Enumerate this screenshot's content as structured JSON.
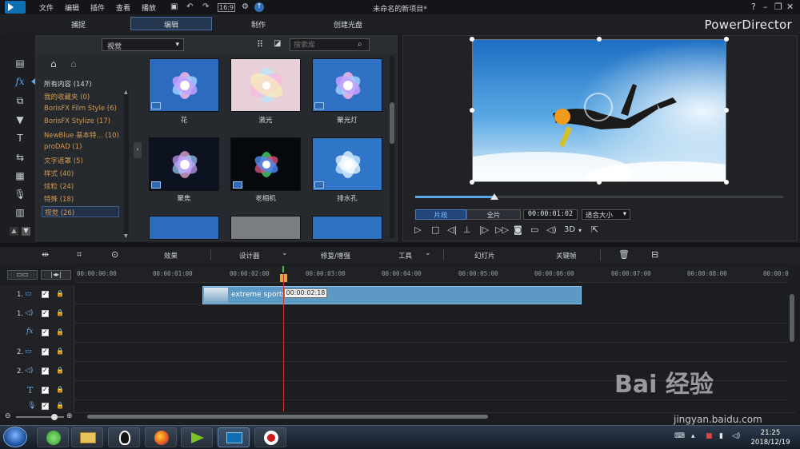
{
  "window": {
    "title": "未命名的新项目*",
    "menu": [
      "文件",
      "编辑",
      "插件",
      "查看",
      "播放"
    ],
    "brand": "PowerDirector"
  },
  "modes": {
    "capture": "捕捉",
    "edit": "编辑",
    "produce": "制作",
    "disc": "创建光盘"
  },
  "library": {
    "category_select": "视觉",
    "search_placeholder": "搜索库",
    "categories": [
      {
        "label": "所有内容 (147)",
        "style": "white"
      },
      {
        "label": "我的收藏夹 (0)",
        "style": "orange"
      },
      {
        "label": "BorisFX Film Style (6)",
        "style": "orange"
      },
      {
        "label": "BorisFX Stylize (17)",
        "style": "orange"
      },
      {
        "label": "NewBlue 基本特... (10)",
        "style": "orange"
      },
      {
        "label": "proDAD (1)",
        "style": "orange"
      },
      {
        "label": "文字遮罩 (5)",
        "style": "orange"
      },
      {
        "label": "样式 (40)",
        "style": "orange"
      },
      {
        "label": "炫粒 (24)",
        "style": "orange"
      },
      {
        "label": "特殊 (18)",
        "style": "orange"
      },
      {
        "label": "视觉 (26)",
        "style": "selected"
      }
    ],
    "effects": [
      {
        "label": "花",
        "style": "flower"
      },
      {
        "label": "激光",
        "style": "laser"
      },
      {
        "label": "聚光灯",
        "style": "flower"
      },
      {
        "label": "聚焦",
        "style": "focus"
      },
      {
        "label": "老相机",
        "style": "oldcam"
      },
      {
        "label": "排水孔",
        "style": "flower"
      }
    ]
  },
  "preview": {
    "clip_btn": "片段",
    "full_btn": "全片",
    "timecode": "00:00:01:02",
    "fit": "适合大小",
    "mode3d": "3D",
    "progress": 0.215
  },
  "edit_toolbar": {
    "effects": "效果",
    "designer": "设计器",
    "fix": "修复/增强",
    "tools": "工具",
    "slideshow": "幻灯片",
    "keyframe": "关键帧"
  },
  "timeline": {
    "ticks": [
      "00:00:00:00",
      "00:00:01:00",
      "00:00:02:00",
      "00:00:03:00",
      "00:00:04:00",
      "00:00:05:00",
      "00:00:06:00",
      "00:00:07:00",
      "00:00:08:00",
      "00:00:0"
    ],
    "tooltip": "00:00:02:18",
    "clip_name": "extreme sports",
    "tracks": [
      {
        "num": "1.",
        "icon": "video-icon"
      },
      {
        "num": "1.",
        "icon": "audio-icon"
      },
      {
        "num": "",
        "icon": "fx-icon"
      },
      {
        "num": "2.",
        "icon": "video-icon"
      },
      {
        "num": "2.",
        "icon": "audio-icon"
      },
      {
        "num": "",
        "icon": "text-icon"
      },
      {
        "num": "",
        "icon": "mic-icon"
      }
    ]
  },
  "taskbar": {
    "time": "21:25",
    "date": "2018/12/19"
  },
  "watermark": {
    "logo": "Bai 经验",
    "url": "jingyan.baidu.com"
  }
}
